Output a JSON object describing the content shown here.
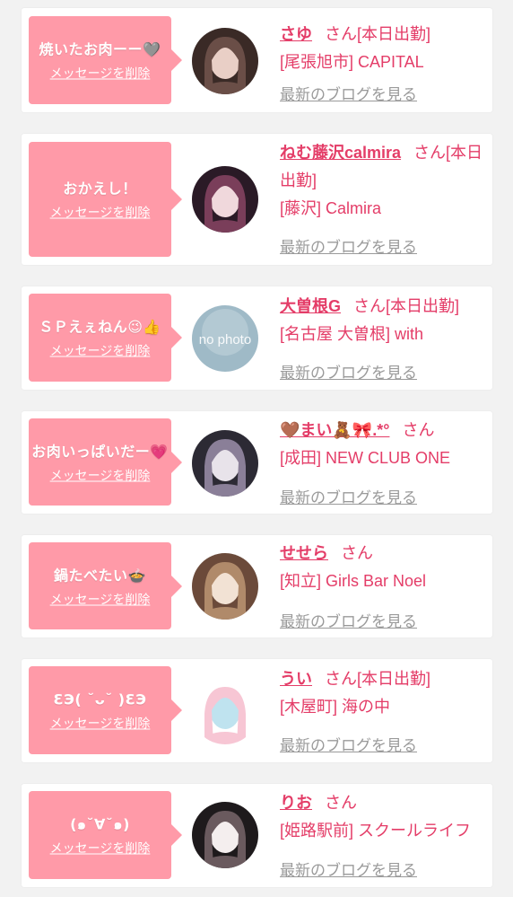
{
  "delete_label": "メッセージを削除",
  "blog_label": "最新のブログを見る",
  "san": "さん",
  "colors": {
    "bubble": "#ff9aa8",
    "name": "#e43d68",
    "blog_link": "#9a9a9a",
    "background": "#f2f2f2"
  },
  "items": [
    {
      "message": "焼いたお肉ーー🩶",
      "name": "さゆ",
      "status": "[本日出勤]",
      "shop": "[尾張旭市] CAPITAL",
      "avatar": "girl-photo"
    },
    {
      "message": "おかえし！",
      "name": "ねむ藤沢calmira",
      "status": "[本日出勤]",
      "shop": "[藤沢] Calmira",
      "avatar": "girl-photo"
    },
    {
      "message": "ＳＰえぇねん😉👍",
      "name": "大曽根G",
      "status": "[本日出勤]",
      "shop": "[名古屋 大曽根] with",
      "avatar": "no-photo",
      "avatar_text": "no photo"
    },
    {
      "message": "お肉いっぱいだー💗",
      "name": "🤎まい🧸🎀.*°",
      "status": "",
      "shop": "[成田] NEW CLUB ONE",
      "avatar": "girl-photo"
    },
    {
      "message": "鍋たべたい🍲",
      "name": "せせら",
      "status": "",
      "shop": "[知立] Girls Bar Noel",
      "avatar": "girl-photo"
    },
    {
      "message": "ƐЭ( ˘ᴗ˘ )ƐЭ",
      "name": "うい",
      "status": "[本日出勤]",
      "shop": "[木屋町] 海の中",
      "avatar": "girl-photo"
    },
    {
      "message": "(๑˘∀˘๑)",
      "name": "りお",
      "status": "",
      "shop": "[姫路駅前] スクールライフ",
      "avatar": "girl-photo"
    }
  ]
}
